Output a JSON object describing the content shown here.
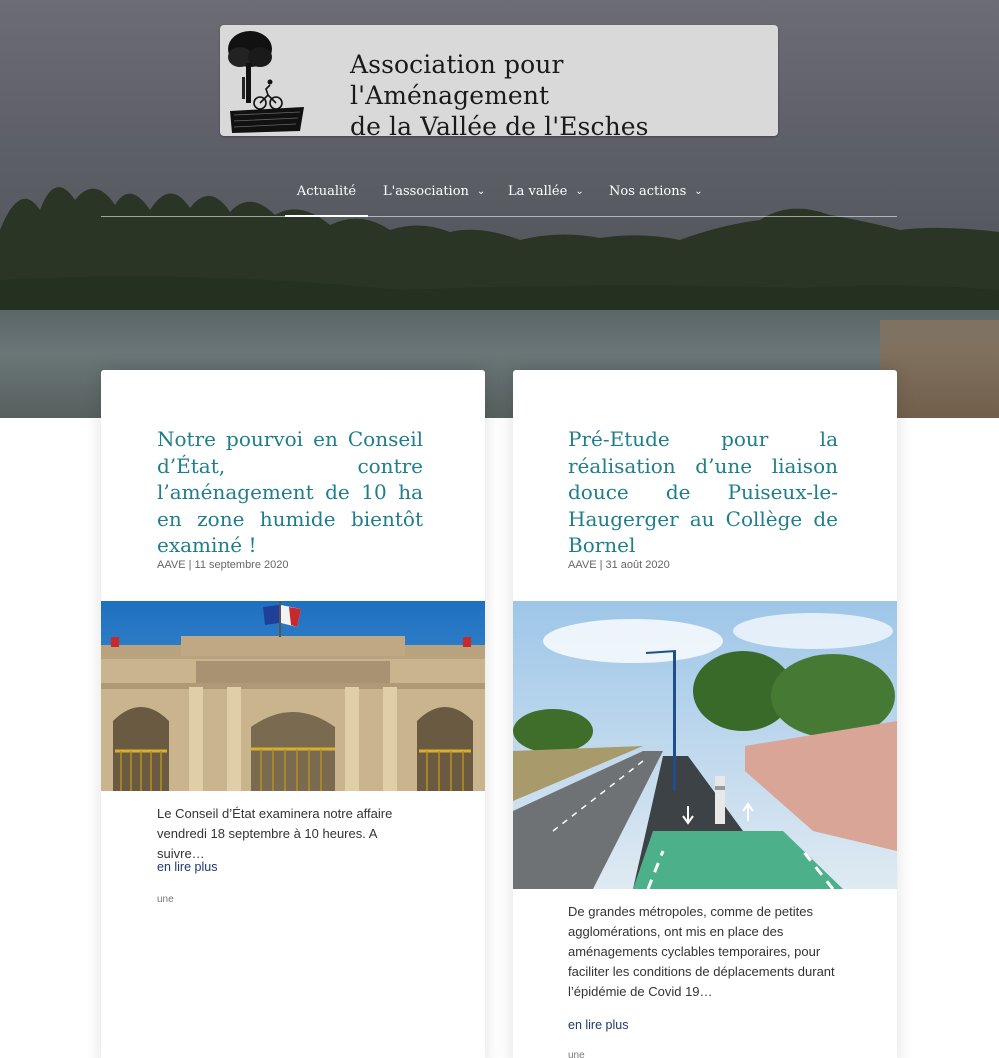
{
  "header": {
    "title_line1": "Association pour l'Aménagement",
    "title_line2": "de la Vallée de l'Esches"
  },
  "nav": {
    "items": [
      {
        "label": "Actualité",
        "active": true,
        "has_dropdown": false
      },
      {
        "label": "L'association",
        "active": false,
        "has_dropdown": true
      },
      {
        "label": "La vallée",
        "active": false,
        "has_dropdown": true
      },
      {
        "label": "Nos actions",
        "active": false,
        "has_dropdown": true
      }
    ],
    "chevron": "⌄"
  },
  "posts": [
    {
      "title": "Notre pourvoi en Conseil d’État, contre l’aménagement de 10 ha en zone humide bientôt examiné !",
      "author": "AAVE",
      "date": "11 septembre 2020",
      "image_alt": "Conseil d'État building facade",
      "excerpt": "Le Conseil d’État examinera notre affaire vendredi 18 septembre à 10 heures. A suivre…",
      "read_more": "en lire plus",
      "tag": "une"
    },
    {
      "title": "Pré-Etude pour la réalisation d’une liaison douce de Puiseux-le-Haugerger au Collège de Bornel",
      "author": "AAVE",
      "date": "31 août 2020",
      "image_alt": "Cycle lane along a road",
      "excerpt": "De grandes métropoles, comme de petites agglomérations, ont mis en place des aménagements cyclables temporaires, pour faciliter les conditions de déplacements durant l’épidémie de Covid 19…",
      "read_more": "en lire plus",
      "tag": "une"
    }
  ],
  "colors": {
    "title": "#1f7e8c",
    "link": "#1c3a6e",
    "logo_bg": "#d9d9d9"
  }
}
